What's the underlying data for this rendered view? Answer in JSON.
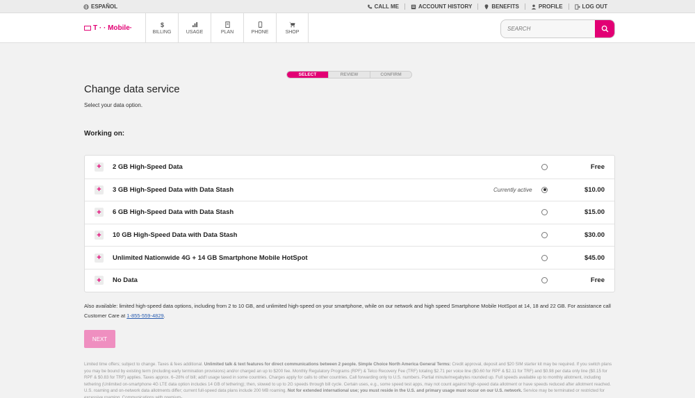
{
  "utility": {
    "language": "ESPAÑOL",
    "links": [
      {
        "label": "CALL ME",
        "icon": "phone-icon"
      },
      {
        "label": "ACCOUNT HISTORY",
        "icon": "history-icon"
      },
      {
        "label": "BENEFITS",
        "icon": "pin-icon"
      },
      {
        "label": "PROFILE",
        "icon": "person-icon"
      },
      {
        "label": "LOG OUT",
        "icon": "logout-icon"
      }
    ]
  },
  "header": {
    "logo": "T · · Mobile·",
    "nav": [
      {
        "label": "BILLING",
        "icon": "dollar-icon"
      },
      {
        "label": "USAGE",
        "icon": "bars-icon"
      },
      {
        "label": "PLAN",
        "icon": "document-icon"
      },
      {
        "label": "PHONE",
        "icon": "phone-device-icon"
      },
      {
        "label": "SHOP",
        "icon": "cart-icon"
      }
    ],
    "search_placeholder": "SEARCH"
  },
  "steps": [
    "SELECT",
    "REVIEW",
    "CONFIRM"
  ],
  "page": {
    "title": "Change data service",
    "subtitle": "Select your data option.",
    "working_on": "Working on:"
  },
  "plans": [
    {
      "name": "2 GB High-Speed Data",
      "note": "",
      "price": "Free",
      "selected": false
    },
    {
      "name": "3 GB High-Speed Data with Data Stash",
      "note": "Currently active",
      "price": "$10.00",
      "selected": true
    },
    {
      "name": "6 GB High-Speed Data with Data Stash",
      "note": "",
      "price": "$15.00",
      "selected": false
    },
    {
      "name": "10 GB High-Speed Data with Data Stash",
      "note": "",
      "price": "$30.00",
      "selected": false
    },
    {
      "name": "Unlimited Nationwide 4G + 14 GB Smartphone Mobile HotSpot",
      "note": "",
      "price": "$45.00",
      "selected": false
    },
    {
      "name": "No Data",
      "note": "",
      "price": "Free",
      "selected": false
    }
  ],
  "also_available": {
    "text": "Also available: limited high-speed data options, including from 2 to 10 GB, and unlimited high-speed on your smartphone, while on our network and high speed Smartphone Mobile HotSpot at 14, 18 and 22 GB. For assistance call Customer Care at ",
    "phone": "1-855-559-4829",
    "end": "."
  },
  "next_label": "NEXT",
  "legal": {
    "p1": "Limited time offers; subject to change. Taxes & fees additional. ",
    "b1": "Unlimited talk & text features for direct communications between 2 people. Simple Choice North America General Terms:",
    "p2": " Credit approval, deposit and $20 SIM starter kit may be required. If you switch plans you may be bound by existing term (including early termination provisions) and/or charged an up to $200 fee. Monthly Regulatory Programs (RPF) & Telco Recovery Fee (TRF) totaling $2.71 per voice line ($0.60 for RPF & $2.11 for TRF) and $0.98 per data only line ($0.15 for RPF & $0.83 for TRF) applies. Taxes approx. 6–28% of bill; add'l usage taxed in some countries. Charges apply for calls to other countries. Call forwarding only to U.S. numbers. Partial minute/megabytes rounded up. Full speeds available up to monthly allotment, including tethering (Unlimited on-smartphone 4G LTE data option includes 14 GB of tethering); then, slowed to up to 2G speeds through bill cycle. Certain uses, e.g., some speed test apps, may not count against high-speed data allotment or have speeds reduced after allotment reached. U.S. roaming and on-network data allotments differ; current full-speed data plans include 200 MB roaming. ",
    "b2": "Not for extended international use; you must reside in the U.S. and primary usage must occur on our U.S. network.",
    "p3": " Service may be terminated or restricted for excessive roaming. Communications with premium-"
  }
}
